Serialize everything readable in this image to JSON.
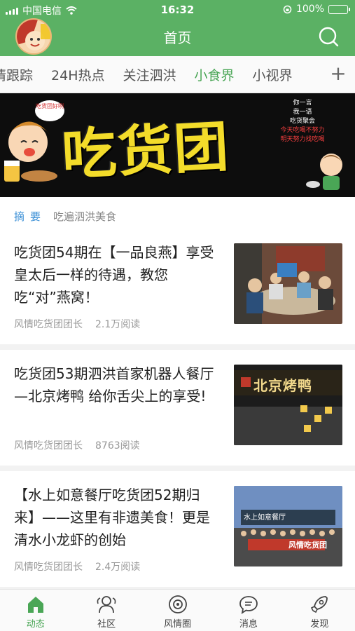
{
  "status_bar": {
    "carrier": "中国电信",
    "time": "16:32",
    "battery": "100%"
  },
  "header": {
    "title": "首页",
    "avatar_icon": "avatar-icon",
    "search_icon": "search-icon"
  },
  "tabs": [
    "情跟踪",
    "24H热点",
    "关注泗洪",
    "小食界",
    "小视界"
  ],
  "active_tab": "小食界",
  "banner": {
    "title": "吃货团",
    "sticker": "吃货团好咧",
    "note_lines": [
      "你一言",
      "我一语",
      "吃货聚会",
      "今天吃喝不努力",
      "明天努力找吃喝"
    ]
  },
  "abstract": {
    "tag": "摘要",
    "text": "吃遍泗洪美食"
  },
  "articles": [
    {
      "title": "吃货团54期在【一品良燕】享受皇太后一样的待遇，教您吃“对”燕窝！",
      "author": "风情吃货团团长",
      "reads": "2.1万阅读"
    },
    {
      "title": "吃货团53期泗洪首家机器人餐厅—北京烤鸭 给你舌尖上的享受!",
      "author": "风情吃货团团长",
      "reads": "8763阅读",
      "thumb_text": "北京烤鸭"
    },
    {
      "title": "【水上如意餐厅吃货团52期归来】——这里有非遗美食！更是清水小龙虾的创始",
      "author": "风情吃货团团长",
      "reads": "2.4万阅读",
      "thumb_text": "水上如意餐厅",
      "thumb_banner": "风情吃货团"
    }
  ],
  "bottom_nav": [
    {
      "label": "动态",
      "icon": "home-icon"
    },
    {
      "label": "社区",
      "icon": "community-icon"
    },
    {
      "label": "风情圈",
      "icon": "circle-icon"
    },
    {
      "label": "消息",
      "icon": "message-icon"
    },
    {
      "label": "发现",
      "icon": "rocket-icon"
    }
  ],
  "colors": {
    "brand_green": "#5bb164",
    "active_green": "#4aa656",
    "banner_yellow": "#f3dc2a",
    "tag_blue": "#3a8fd6"
  }
}
